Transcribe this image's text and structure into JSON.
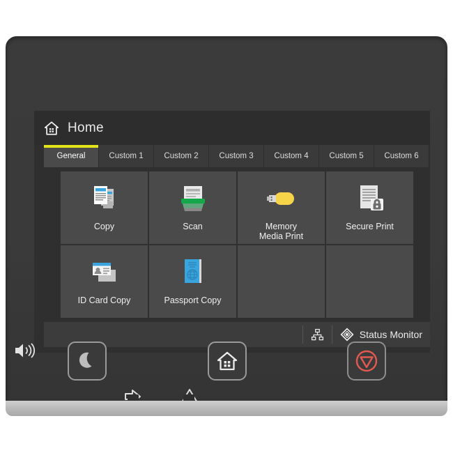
{
  "device": {
    "type": "printer-control-panel"
  },
  "screen": {
    "header": {
      "icon": "home-icon",
      "title": "Home"
    },
    "tabs": [
      {
        "label": "General",
        "active": true
      },
      {
        "label": "Custom 1",
        "active": false
      },
      {
        "label": "Custom 2",
        "active": false
      },
      {
        "label": "Custom 3",
        "active": false
      },
      {
        "label": "Custom 4",
        "active": false
      },
      {
        "label": "Custom 5",
        "active": false
      },
      {
        "label": "Custom 6",
        "active": false
      }
    ],
    "tiles": [
      {
        "label": "Copy",
        "icon": "copy-documents-icon",
        "empty": false
      },
      {
        "label": "Scan",
        "icon": "scanner-icon",
        "empty": false
      },
      {
        "label": "Memory\nMedia Print",
        "icon": "usb-drive-icon",
        "empty": false
      },
      {
        "label": "Secure Print",
        "icon": "document-lock-icon",
        "empty": false
      },
      {
        "label": "ID Card Copy",
        "icon": "id-card-icon",
        "empty": false
      },
      {
        "label": "Passport Copy",
        "icon": "passport-icon",
        "empty": false
      },
      {
        "label": "",
        "icon": "",
        "empty": true
      },
      {
        "label": "",
        "icon": "",
        "empty": true
      }
    ],
    "status_bar": {
      "network_icon": "network-icon",
      "monitor_icon": "status-monitor-icon",
      "monitor_label": "Status Monitor"
    }
  },
  "hardware": {
    "speaker_icon": "speaker-volume-icon",
    "buttons": [
      {
        "name": "energy-saver-button",
        "icon": "moon-icon"
      },
      {
        "name": "home-button",
        "icon": "house-icon"
      },
      {
        "name": "stop-button",
        "icon": "stop-icon"
      }
    ],
    "indicators": [
      {
        "name": "data-indicator",
        "icon": "arrow-into-box-icon"
      },
      {
        "name": "error-indicator",
        "icon": "warning-triangle-icon"
      }
    ]
  },
  "colors": {
    "screen_bg": "#2f2f2f",
    "tile_bg": "#4a4a4a",
    "tab_active_underline": "#e3e31a",
    "accent_blue": "#3aa4dd",
    "accent_green": "#15a84a",
    "accent_yellow": "#f5d44a",
    "stop_red": "#e05a52"
  }
}
